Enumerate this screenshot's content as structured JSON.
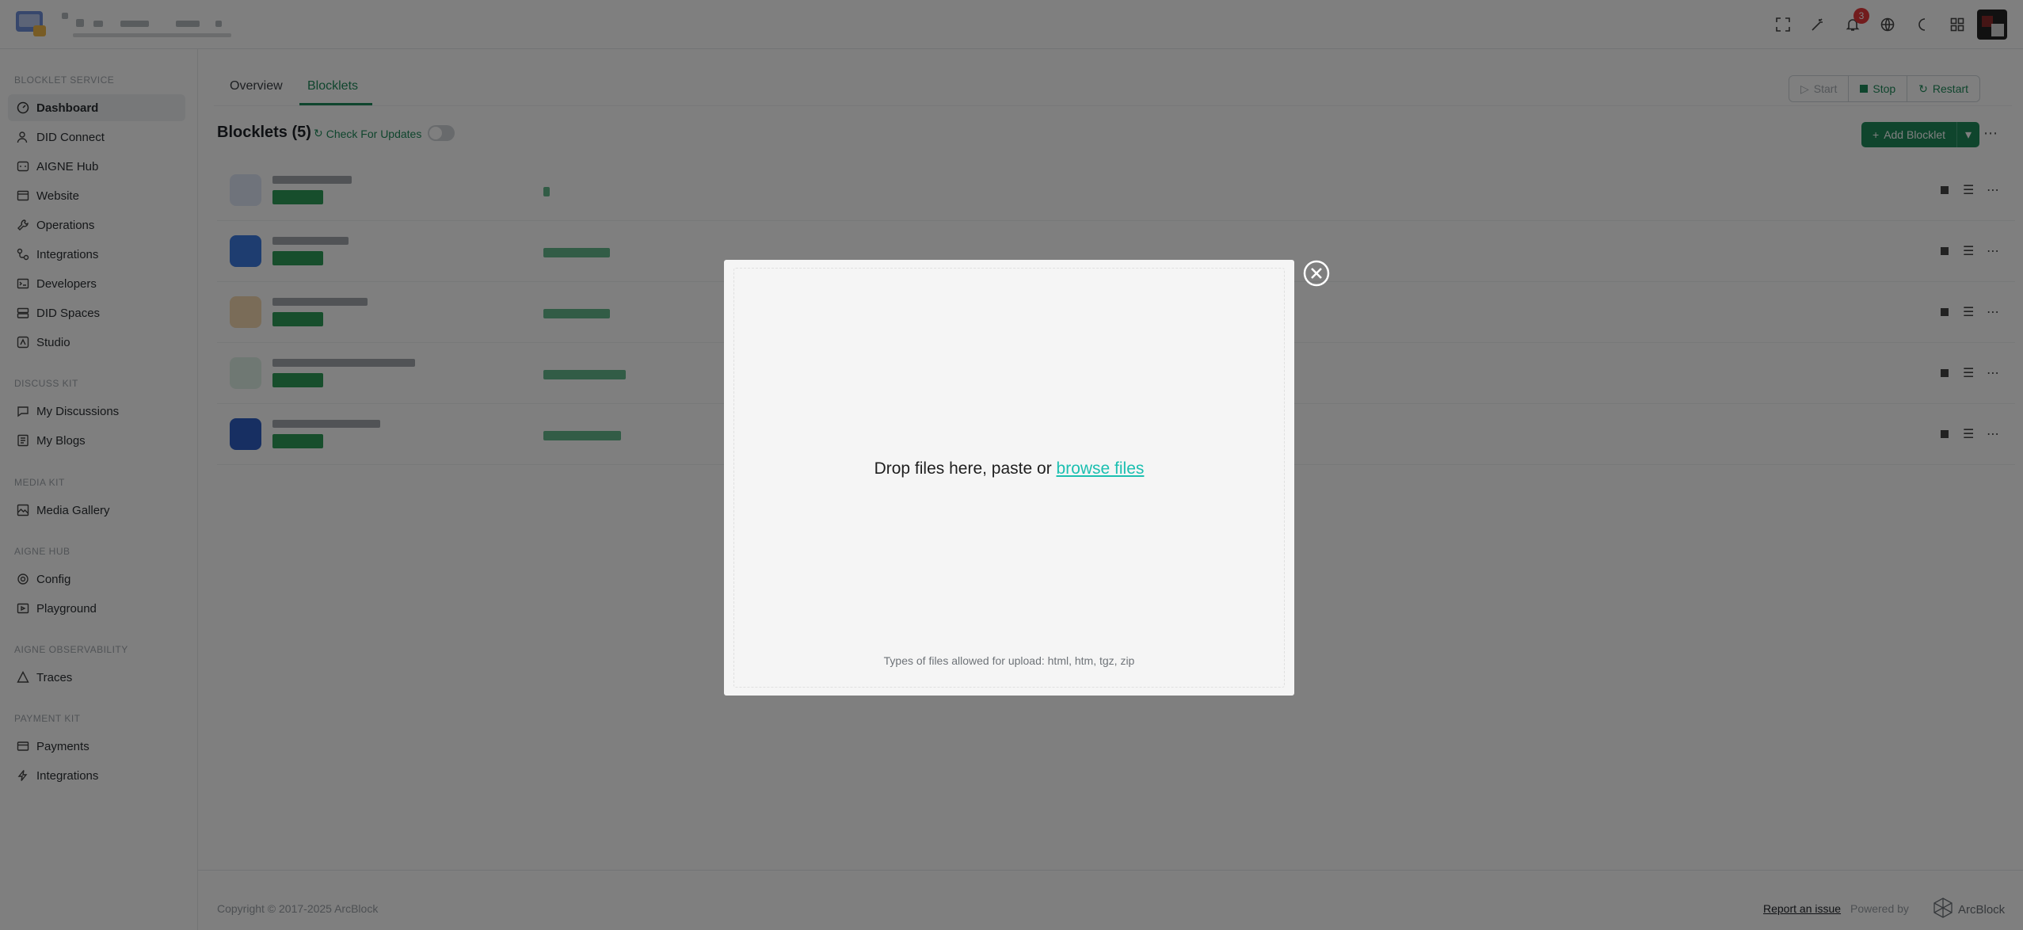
{
  "header": {
    "notification_count": "3"
  },
  "sidebar": {
    "sections": [
      {
        "label": "BLOCKLET SERVICE"
      },
      {
        "label": "DISCUSS KIT"
      },
      {
        "label": "MEDIA KIT"
      },
      {
        "label": "AIGNE HUB"
      },
      {
        "label": "AIGNE OBSERVABILITY"
      },
      {
        "label": "PAYMENT KIT"
      }
    ],
    "items": [
      {
        "label": "Dashboard",
        "icon": "dashboard-icon"
      },
      {
        "label": "DID Connect",
        "icon": "user-icon"
      },
      {
        "label": "AIGNE Hub",
        "icon": "hub-icon"
      },
      {
        "label": "Website",
        "icon": "browser-icon"
      },
      {
        "label": "Operations",
        "icon": "wrench-icon"
      },
      {
        "label": "Integrations",
        "icon": "integrations-icon"
      },
      {
        "label": "Developers",
        "icon": "terminal-icon"
      },
      {
        "label": "DID Spaces",
        "icon": "stack-icon"
      },
      {
        "label": "Studio",
        "icon": "studio-icon"
      },
      {
        "label": "My Discussions",
        "icon": "chat-icon"
      },
      {
        "label": "My Blogs",
        "icon": "blog-icon"
      },
      {
        "label": "Media Gallery",
        "icon": "gallery-icon"
      },
      {
        "label": "Config",
        "icon": "gear-icon"
      },
      {
        "label": "Playground",
        "icon": "playground-icon"
      },
      {
        "label": "Traces",
        "icon": "traces-icon"
      },
      {
        "label": "Payments",
        "icon": "card-icon"
      },
      {
        "label": "Integrations",
        "icon": "bolt-icon"
      }
    ]
  },
  "main": {
    "tabs": [
      {
        "label": "Overview"
      },
      {
        "label": "Blocklets"
      }
    ],
    "actions": {
      "start": "Start",
      "stop": "Stop",
      "restart": "Restart"
    },
    "title": "Blocklets (5)",
    "check_updates": "Check For Updates",
    "add_blocklet": "Add Blocklet"
  },
  "footer": {
    "copyright": "Copyright © 2017-2025 ArcBlock",
    "report": "Report an issue",
    "powered_by": "Powered by",
    "brand": "ArcBlock"
  },
  "modal": {
    "drop_text": "Drop files here, paste or ",
    "browse_text": "browse files",
    "types_text": "Types of files allowed for upload: html, htm, tgz, zip"
  }
}
